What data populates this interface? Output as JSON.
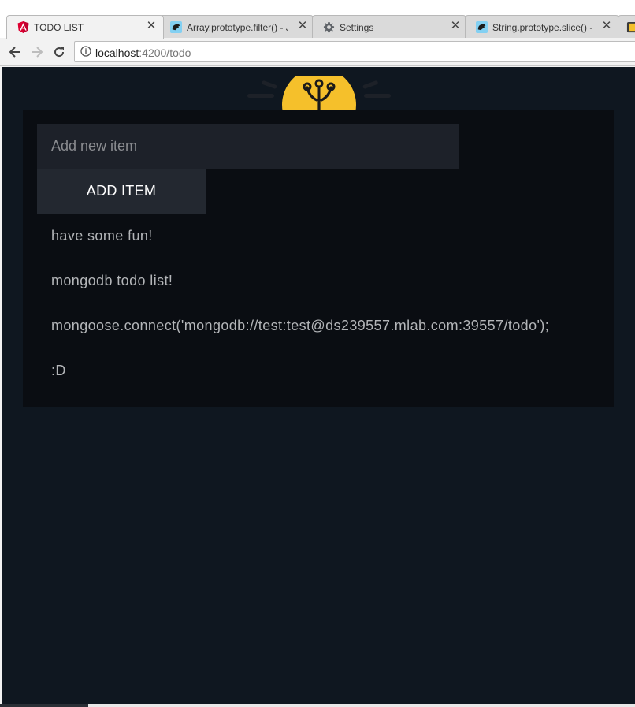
{
  "browser": {
    "tabs": [
      {
        "title": "TODO LIST",
        "icon": "angular-icon",
        "active": true
      },
      {
        "title": "Array.prototype.filter() - J",
        "icon": "mdn-dino-icon",
        "active": false
      },
      {
        "title": "Settings",
        "icon": "gear-icon",
        "active": false
      },
      {
        "title": "String.prototype.slice() -",
        "icon": "mdn-dino-icon",
        "active": false
      }
    ],
    "address": {
      "host": "localhost",
      "path": ":4200/todo"
    }
  },
  "app": {
    "input_placeholder": "Add new item",
    "add_button_label": "ADD ITEM",
    "items": [
      "have some fun!",
      "mongodb todo list!",
      "mongoose.connect('mongodb://test:test@ds239557.mlab.com:39557/todo');",
      ":D"
    ]
  },
  "colors": {
    "page_background": "#0f1720",
    "card_background": "#0a0d12",
    "input_background": "#1d2129",
    "button_background": "#232830",
    "item_text": "#b3b5b8",
    "logo_yellow": "#f5c02b"
  }
}
